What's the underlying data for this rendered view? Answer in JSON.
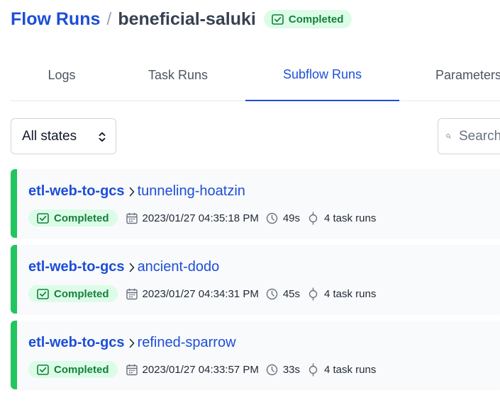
{
  "header": {
    "breadcrumb_root": "Flow Runs",
    "separator": "/",
    "flow_run_name": "beneficial-saluki",
    "state_badge": "Completed"
  },
  "tabs": [
    {
      "label": "Logs"
    },
    {
      "label": "Task Runs"
    },
    {
      "label": "Subflow Runs",
      "active": true
    },
    {
      "label": "Parameters"
    }
  ],
  "filters": {
    "state_select": "All states",
    "search_placeholder": "Search"
  },
  "subflow_runs": [
    {
      "flow_name": "etl-web-to-gcs",
      "run_name": "tunneling-hoatzin",
      "state": "Completed",
      "start_time": "2023/01/27 04:35:18 PM",
      "duration": "49s",
      "task_runs": "4 task runs"
    },
    {
      "flow_name": "etl-web-to-gcs",
      "run_name": "ancient-dodo",
      "state": "Completed",
      "start_time": "2023/01/27 04:34:31 PM",
      "duration": "45s",
      "task_runs": "4 task runs"
    },
    {
      "flow_name": "etl-web-to-gcs",
      "run_name": "refined-sparrow",
      "state": "Completed",
      "start_time": "2023/01/27 04:33:57 PM",
      "duration": "33s",
      "task_runs": "4 task runs"
    }
  ],
  "icons": {
    "state": "check-square-icon",
    "start_time": "calendar-icon",
    "duration": "clock-icon",
    "task_runs": "task-run-icon",
    "breadcrumb_arrow": "chevron-right-icon",
    "select": "chevron-up-down-icon",
    "search": "search-icon"
  },
  "colors": {
    "link": "#1d4ed8",
    "completed_text": "#15803d",
    "completed_bg": "#dcfce7",
    "completed_bar": "#22c55e",
    "card_bg": "#f9fafb"
  }
}
